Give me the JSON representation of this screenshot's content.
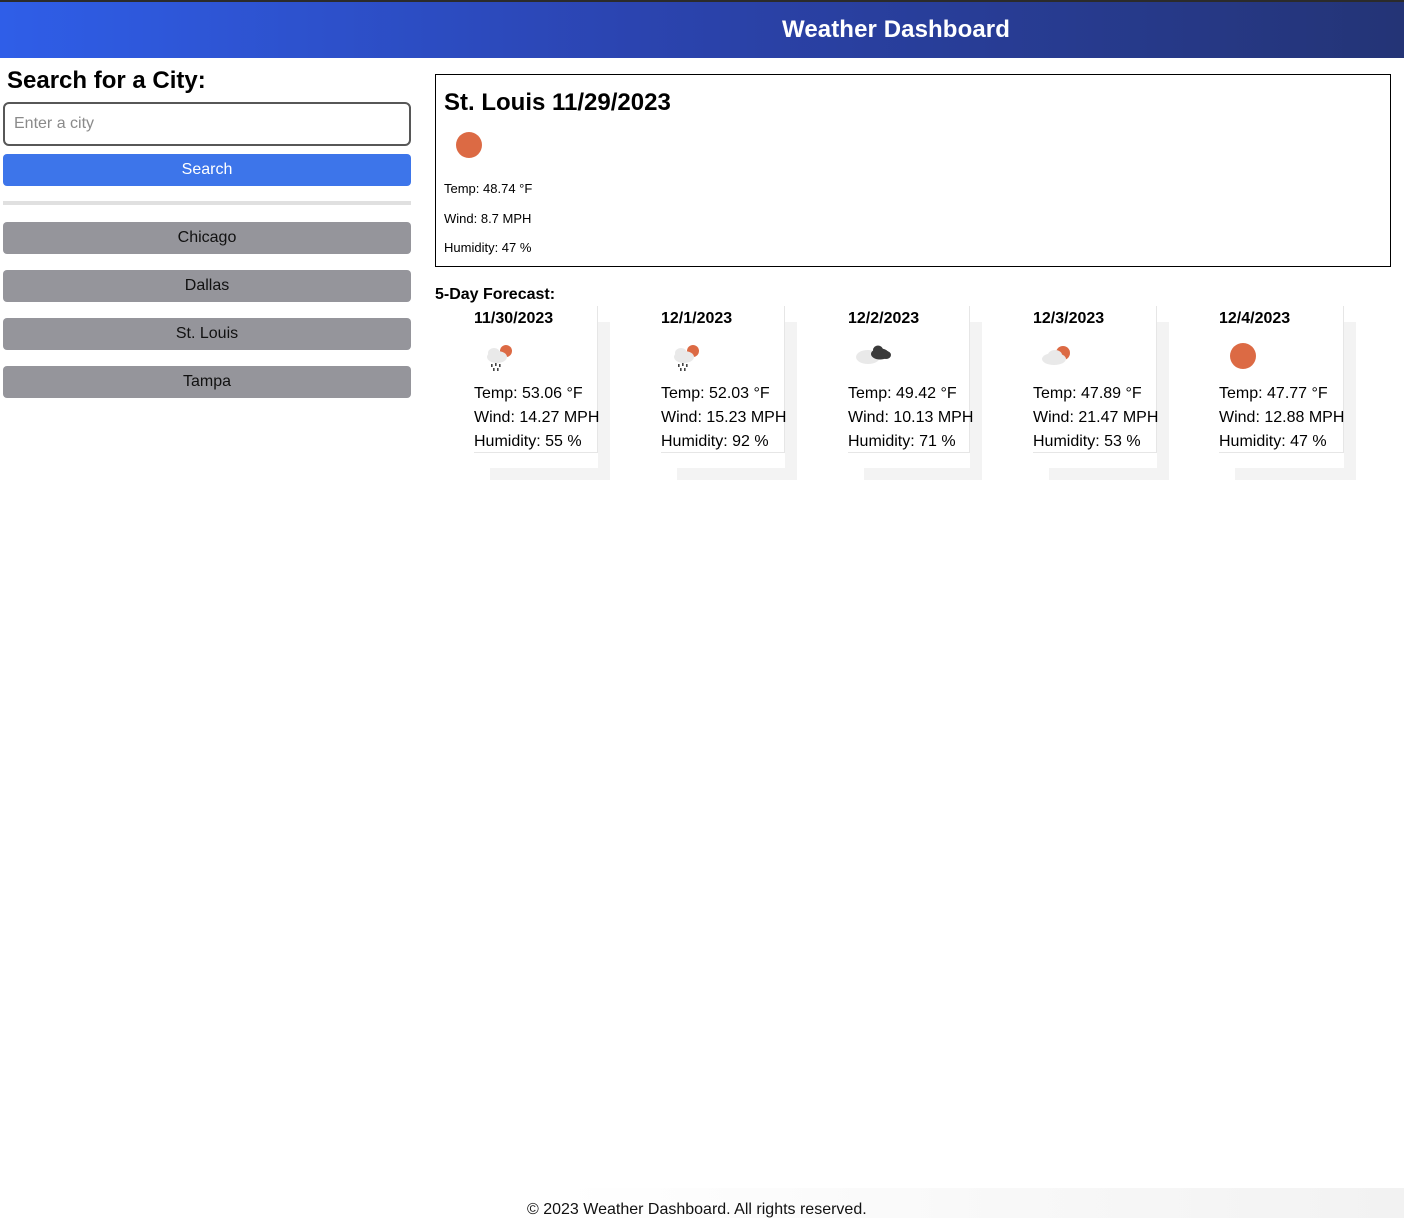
{
  "header": {
    "title": "Weather Dashboard"
  },
  "sidebar": {
    "search_title": "Search for a City:",
    "search_placeholder": "Enter a city",
    "search_value": "",
    "search_button": "Search",
    "history": [
      "Chicago",
      "Dallas",
      "St. Louis",
      "Tampa"
    ]
  },
  "current": {
    "heading": "St. Louis 11/29/2023",
    "icon": "clear-sun-icon",
    "temp": "Temp: 48.74 °F",
    "wind": "Wind: 8.7 MPH",
    "humidity": "Humidity: 47 %"
  },
  "forecast": {
    "title": "5-Day Forecast:",
    "days": [
      {
        "date": "11/30/2023",
        "icon": "rain-sun-cloud-icon",
        "temp": "Temp: 53.06 °F",
        "wind": "Wind: 14.27 MPH",
        "humidity": "Humidity: 55 %"
      },
      {
        "date": "12/1/2023",
        "icon": "rain-sun-cloud-icon",
        "temp": "Temp: 52.03 °F",
        "wind": "Wind: 15.23 MPH",
        "humidity": "Humidity: 92 %"
      },
      {
        "date": "12/2/2023",
        "icon": "broken-clouds-icon",
        "temp": "Temp: 49.42 °F",
        "wind": "Wind: 10.13 MPH",
        "humidity": "Humidity: 71 %"
      },
      {
        "date": "12/3/2023",
        "icon": "sun-cloud-icon",
        "temp": "Temp: 47.89 °F",
        "wind": "Wind: 21.47 MPH",
        "humidity": "Humidity: 53 %"
      },
      {
        "date": "12/4/2023",
        "icon": "clear-sun-icon",
        "temp": "Temp: 47.77 °F",
        "wind": "Wind: 12.88 MPH",
        "humidity": "Humidity: 47 %"
      }
    ]
  },
  "footer": {
    "text": "© 2023 Weather Dashboard. All rights reserved."
  },
  "colors": {
    "header_gradient_start": "#2f5ee8",
    "header_gradient_end": "#243476",
    "search_button": "#3d75ea",
    "history_button": "#95959b",
    "sun": "#dc6a44",
    "dark_cloud": "#3a3a3a",
    "light_cloud": "#e9e9e9"
  }
}
